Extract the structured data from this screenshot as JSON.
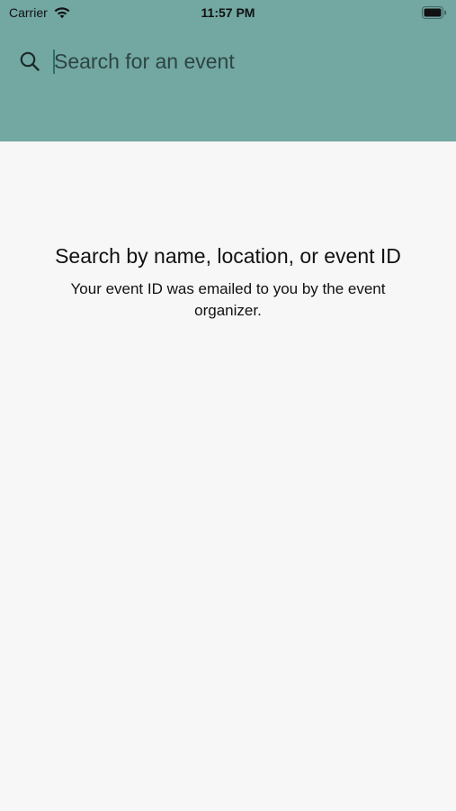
{
  "status_bar": {
    "carrier": "Carrier",
    "time": "11:57 PM",
    "icons": [
      "wifi-icon",
      "battery-icon"
    ]
  },
  "search": {
    "placeholder": "Search for an event",
    "value": "",
    "icon": "search-icon"
  },
  "empty_state": {
    "title": "Search by name, location, or event ID",
    "subtitle": "Your event ID was emailed to you by the event organizer."
  },
  "colors": {
    "header_background": "#72a7a2",
    "page_background": "#f7f7f7",
    "text": "#111111"
  }
}
